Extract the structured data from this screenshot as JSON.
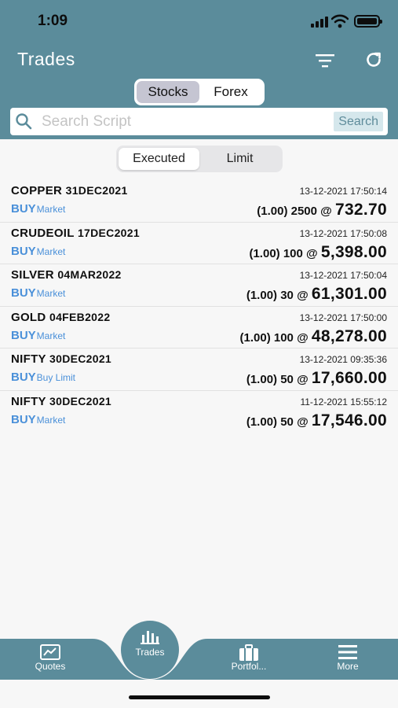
{
  "status_bar": {
    "time": "1:09"
  },
  "header": {
    "title": "Trades"
  },
  "market_tabs": [
    {
      "label": "Stocks",
      "active": true
    },
    {
      "label": "Forex",
      "active": false
    }
  ],
  "search": {
    "placeholder": "Search Script",
    "value": "",
    "button_label": "Search"
  },
  "order_tabs": [
    {
      "label": "Executed",
      "active": true
    },
    {
      "label": "Limit",
      "active": false
    }
  ],
  "trades": [
    {
      "symbol": "COPPER",
      "expiry": "31DEC2021",
      "datetime": "13-12-2021 17:50:14",
      "side": "BUY",
      "order_type": "Market",
      "lot": "(1.00)",
      "qty": "2500",
      "at": "@",
      "price": "732.70"
    },
    {
      "symbol": "CRUDEOIL",
      "expiry": "17DEC2021",
      "datetime": "13-12-2021 17:50:08",
      "side": "BUY",
      "order_type": "Market",
      "lot": "(1.00)",
      "qty": "100",
      "at": "@",
      "price": "5,398.00"
    },
    {
      "symbol": "SILVER",
      "expiry": "04MAR2022",
      "datetime": "13-12-2021 17:50:04",
      "side": "BUY",
      "order_type": "Market",
      "lot": "(1.00)",
      "qty": "30",
      "at": "@",
      "price": "61,301.00"
    },
    {
      "symbol": "GOLD",
      "expiry": "04FEB2022",
      "datetime": "13-12-2021 17:50:00",
      "side": "BUY",
      "order_type": "Market",
      "lot": "(1.00)",
      "qty": "100",
      "at": "@",
      "price": "48,278.00"
    },
    {
      "symbol": "NIFTY",
      "expiry": "30DEC2021",
      "datetime": "13-12-2021 09:35:36",
      "side": "BUY",
      "order_type": "Buy Limit",
      "lot": "(1.00)",
      "qty": "50",
      "at": "@",
      "price": "17,660.00"
    },
    {
      "symbol": "NIFTY",
      "expiry": "30DEC2021",
      "datetime": "11-12-2021 15:55:12",
      "side": "BUY",
      "order_type": "Market",
      "lot": "(1.00)",
      "qty": "50",
      "at": "@",
      "price": "17,546.00"
    }
  ],
  "tabbar": {
    "quotes": "Quotes",
    "trades": "Trades",
    "portfolio": "Portfol...",
    "more": "More"
  },
  "colors": {
    "header": "#5b8c9b",
    "buy": "#4a90d9",
    "background": "#f7f7f7"
  },
  "icons": {
    "filter": "filter-icon",
    "refresh": "refresh-icon",
    "search": "search-icon",
    "quotes": "chart-icon",
    "trades": "bar-chart-icon",
    "portfolio": "briefcase-icon",
    "more": "menu-icon"
  }
}
